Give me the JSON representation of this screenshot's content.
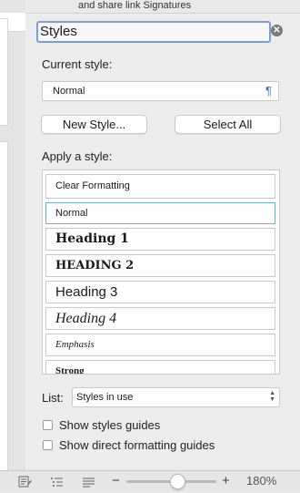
{
  "ribbon": {
    "text": "and share link  Signatures"
  },
  "panel": {
    "title": "Styles",
    "current_style_label": "Current style:",
    "current_style_value": "Normal",
    "new_style_button": "New Style...",
    "select_all_button": "Select All",
    "apply_style_label": "Apply a style:",
    "styles": [
      {
        "label": "Clear Formatting"
      },
      {
        "label": "Normal"
      },
      {
        "label": "Heading 1"
      },
      {
        "label": "HEADING 2"
      },
      {
        "label": "Heading 3"
      },
      {
        "label": "Heading 4"
      },
      {
        "label": "Emphasis"
      },
      {
        "label": "Strong"
      }
    ],
    "list_label": "List:",
    "list_value": "Styles in use",
    "show_styles_guides": "Show styles guides",
    "show_direct_formatting_guides": "Show direct formatting guides"
  },
  "statusbar": {
    "zoom": "180%"
  },
  "colors": {
    "accent": "#7d9ed4",
    "pilcrow": "#3b6fd6"
  }
}
